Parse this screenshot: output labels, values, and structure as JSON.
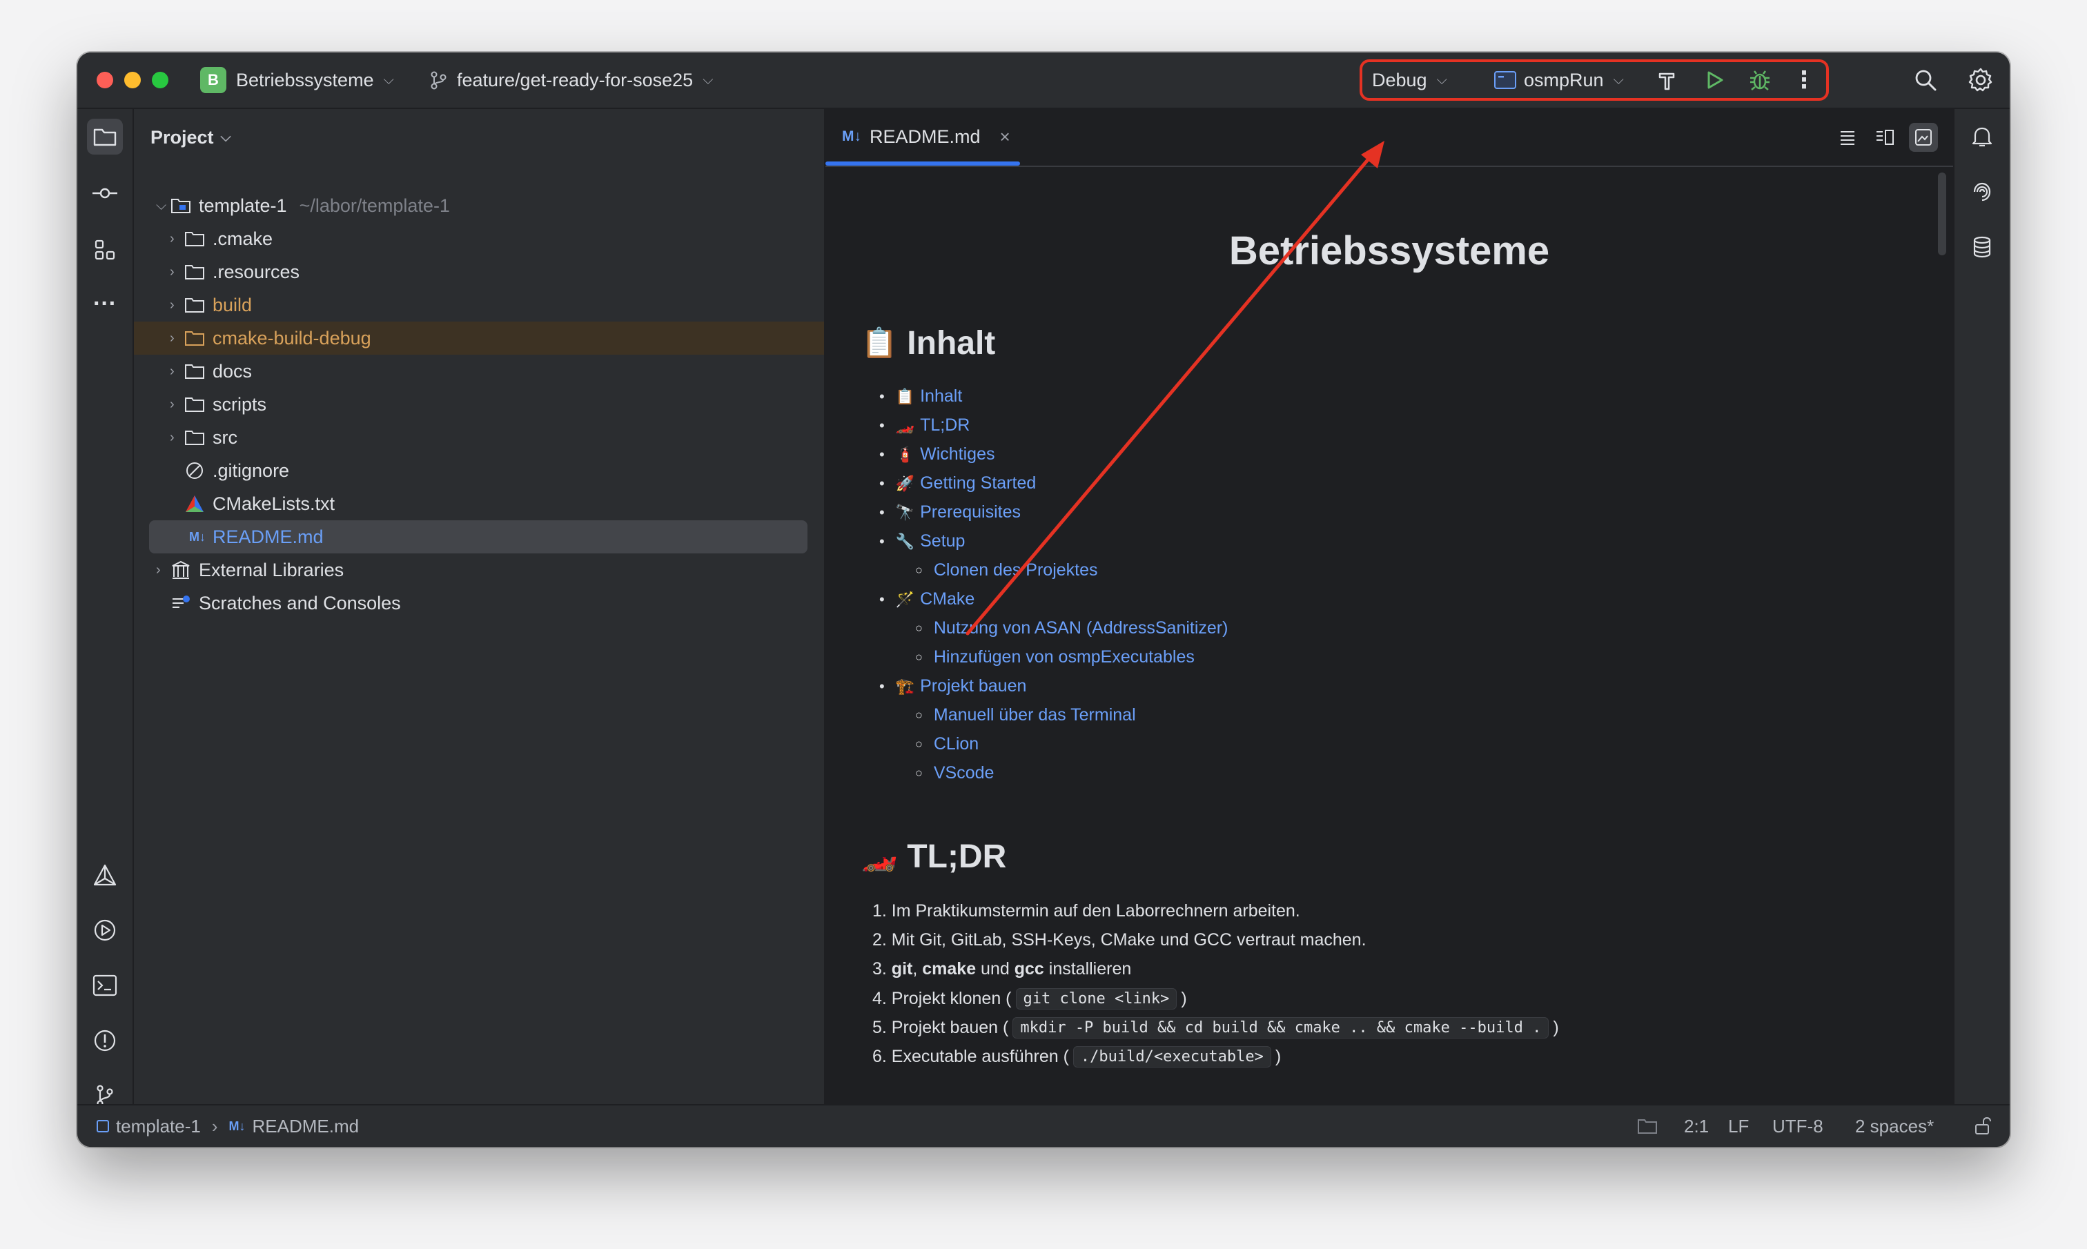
{
  "titlebar": {
    "project_badge": "B",
    "project_name": "Betriebssysteme",
    "branch": "feature/get-ready-for-sose25",
    "run_config_mode": "Debug",
    "run_target": "osmpRun"
  },
  "project_panel": {
    "header": "Project",
    "tree": [
      {
        "label": "template-1",
        "hint": "~/labor/template-1"
      },
      {
        "label": ".cmake"
      },
      {
        "label": ".resources"
      },
      {
        "label": "build"
      },
      {
        "label": "cmake-build-debug"
      },
      {
        "label": "docs"
      },
      {
        "label": "scripts"
      },
      {
        "label": "src"
      },
      {
        "label": ".gitignore"
      },
      {
        "label": "CMakeLists.txt"
      },
      {
        "label": "README.md"
      },
      {
        "label": "External Libraries"
      },
      {
        "label": "Scratches and Consoles"
      }
    ]
  },
  "editor": {
    "tab_badge": "M↓",
    "tab_label": "README.md",
    "doc_title": "Betriebssysteme",
    "h_inhalt": "Inhalt",
    "toc": [
      {
        "label": "Inhalt",
        "emoji": "📋"
      },
      {
        "label": "TL;DR",
        "emoji": "🏎️"
      },
      {
        "label": "Wichtiges",
        "emoji": "🧯"
      },
      {
        "label": "Getting Started",
        "emoji": "🚀"
      },
      {
        "label": "Prerequisites",
        "emoji": "🔭"
      },
      {
        "label": "Setup",
        "emoji": "🔧"
      },
      {
        "label": "Clonen des Projektes"
      },
      {
        "label": "CMake",
        "emoji": "🪄"
      },
      {
        "label": "Nutzung von ASAN (AddressSanitizer)"
      },
      {
        "label": "Hinzufügen von osmpExecutables"
      },
      {
        "label": "Projekt bauen",
        "emoji": "🏗️"
      },
      {
        "label": "Manuell über das Terminal"
      },
      {
        "label": "CLion"
      },
      {
        "label": "VScode"
      }
    ],
    "h_tldr": "TL;DR",
    "tldr": {
      "s1": "1. Im Praktikumstermin auf den Laborrechnern arbeiten.",
      "s2": "2. Mit Git, GitLab, SSH-Keys, CMake und GCC vertraut machen.",
      "s3_num": "3. ",
      "s3_b1": "git",
      "s3_sep1": ", ",
      "s3_b2": "cmake",
      "s3_sep2": " und ",
      "s3_b3": "gcc",
      "s3_tail": " installieren",
      "s4_pre": "4. Projekt klonen (",
      "s4_code": "git clone <link>",
      "s4_post": ")",
      "s5_pre": "5. Projekt bauen (",
      "s5_code": "mkdir -P build && cd build && cmake .. && cmake --build .",
      "s5_post": ")",
      "s6_pre": "6. Executable ausführen (",
      "s6_code": "./build/<executable>",
      "s6_post": ")"
    }
  },
  "statusbar": {
    "crumb_project": "template-1",
    "crumb_badge": "M↓",
    "crumb_file": "README.md",
    "position": "2:1",
    "line_sep": "LF",
    "encoding": "UTF-8",
    "indent": "2 spaces*"
  },
  "colors": {
    "annotation": "#e53223",
    "accent": "#3574f0",
    "link": "#6b9ff8",
    "excluded_folder": "#d9a25b"
  }
}
